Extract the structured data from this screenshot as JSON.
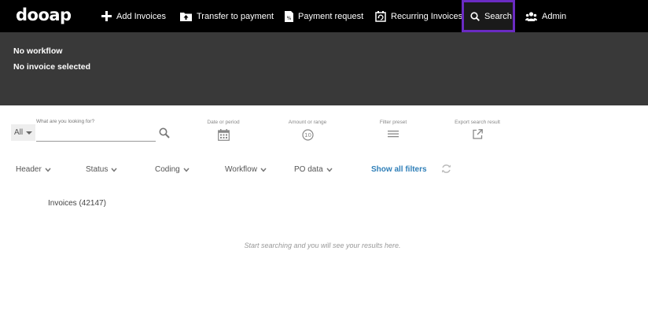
{
  "app": {
    "logo": "dooap"
  },
  "nav": {
    "add_invoices": "Add Invoices",
    "transfer_to_payment": "Transfer to payment",
    "payment_request": "Payment request",
    "recurring_invoices": "Recurring Invoices",
    "search": "Search",
    "admin": "Admin",
    "active_item": "search",
    "active_outline_color": "#6a2bc2"
  },
  "panel": {
    "workflow": "No workflow",
    "invoice": "No invoice selected"
  },
  "search": {
    "scope_value": "All",
    "label": "What are you looking for?",
    "value": "",
    "placeholder": ""
  },
  "tools": {
    "date": "Date or period",
    "amount": "Amount or range",
    "preset": "Filter preset",
    "export": "Export search result"
  },
  "filters": {
    "header": "Header",
    "status": "Status",
    "coding": "Coding",
    "workflow": "Workflow",
    "po_data": "PO data",
    "show_all": "Show all filters",
    "link_color": "#2f7fb8"
  },
  "results": {
    "count_label": "Invoices (42147)",
    "empty_message": "Start searching and you will see your results here."
  }
}
